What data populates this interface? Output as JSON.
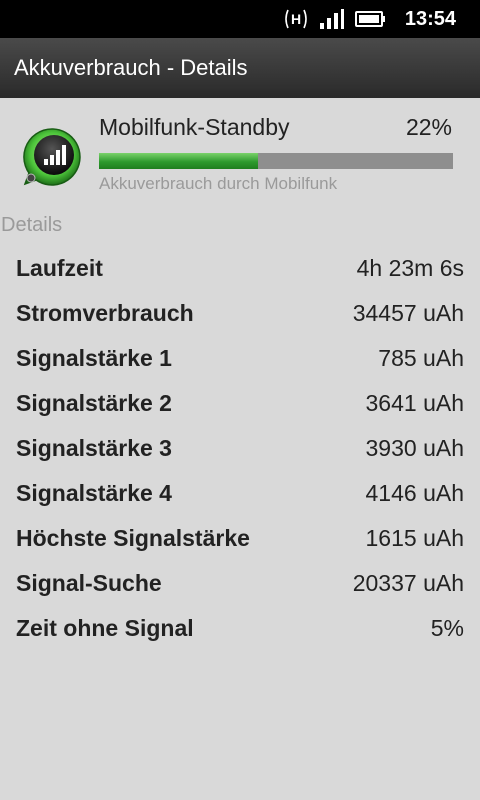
{
  "status_bar": {
    "network": "H",
    "time": "13:54"
  },
  "title_bar": {
    "title": "Akkuverbrauch - Details"
  },
  "summary": {
    "icon": "cell-signal-icon",
    "name": "Mobilfunk-Standby",
    "percent_text": "22%",
    "percent_value": 22,
    "bar_fraction": 0.45,
    "subtitle": "Akkuverbrauch durch Mobilfunk",
    "bar_color": "#2e9a2e"
  },
  "details": {
    "section_label": "Details",
    "rows": [
      {
        "label": "Laufzeit",
        "value": "4h 23m 6s"
      },
      {
        "label": "Stromverbrauch",
        "value": "34457 uAh"
      },
      {
        "label": "Signalstärke 1",
        "value": "785 uAh"
      },
      {
        "label": "Signalstärke 2",
        "value": "3641 uAh"
      },
      {
        "label": "Signalstärke 3",
        "value": "3930 uAh"
      },
      {
        "label": "Signalstärke 4",
        "value": "4146 uAh"
      },
      {
        "label": "Höchste Signalstärke",
        "value": "1615 uAh"
      },
      {
        "label": "Signal-Suche",
        "value": "20337 uAh"
      },
      {
        "label": "Zeit ohne Signal",
        "value": "5%"
      }
    ]
  }
}
